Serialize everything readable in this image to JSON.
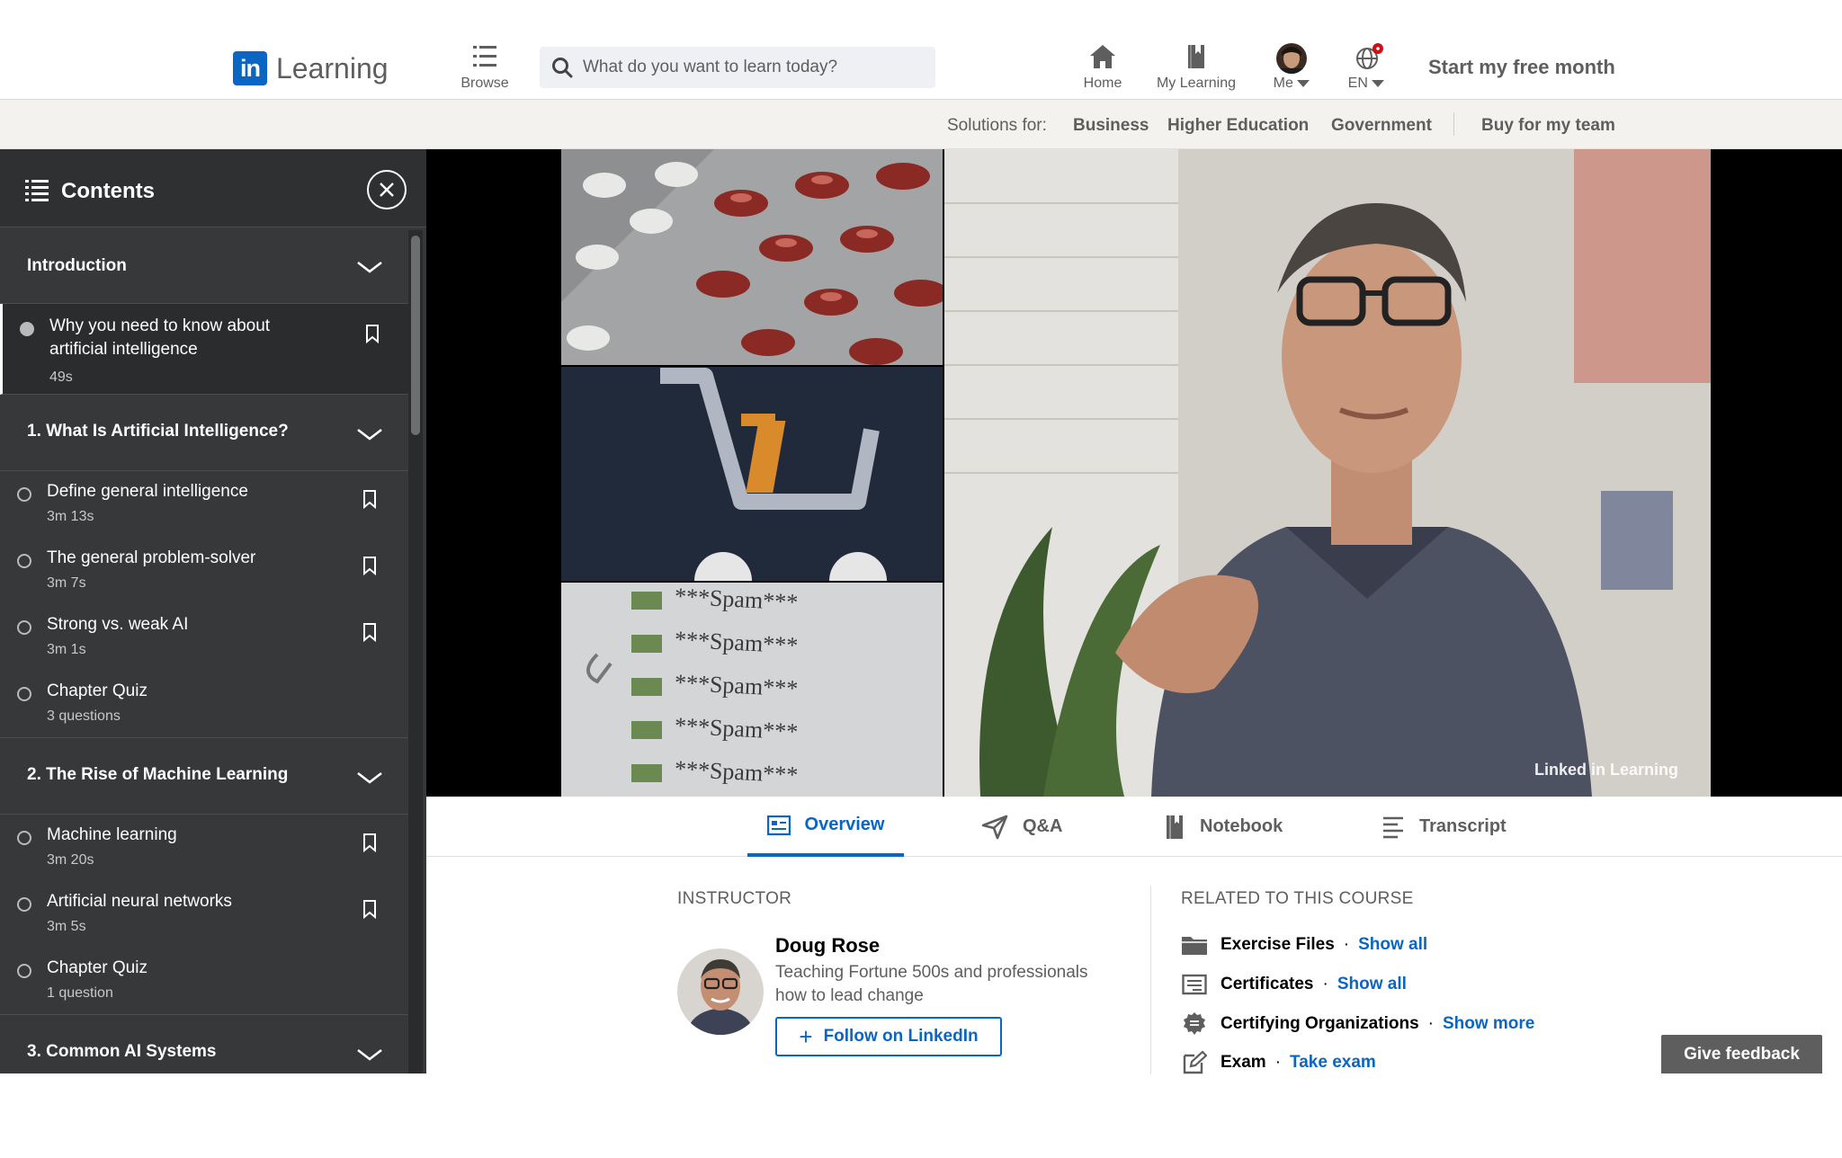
{
  "header": {
    "logo_text": "Learning",
    "logo_badge": "in",
    "browse_label": "Browse",
    "search_placeholder": "What do you want to learn today?",
    "nav": {
      "home": "Home",
      "my_learning": "My Learning",
      "me": "Me",
      "language": "EN"
    },
    "cta": "Start my free month"
  },
  "subbar": {
    "solutions_label": "Solutions for:",
    "business": "Business",
    "higher_education": "Higher Education",
    "government": "Government",
    "buy_team": "Buy for my team"
  },
  "sidebar": {
    "title": "Contents",
    "sections": [
      {
        "title": "Introduction",
        "items": [
          {
            "title": "Why you need to know about artificial intelligence",
            "duration": "49s"
          }
        ]
      },
      {
        "title": "1. What Is Artificial Intelligence?",
        "items": [
          {
            "title": "Define general intelligence",
            "duration": "3m 13s"
          },
          {
            "title": "The general problem-solver",
            "duration": "3m 7s"
          },
          {
            "title": "Strong vs. weak AI",
            "duration": "3m 1s"
          },
          {
            "title": "Chapter Quiz",
            "duration": "3 questions"
          }
        ]
      },
      {
        "title": "2. The Rise of Machine Learning",
        "items": [
          {
            "title": "Machine learning",
            "duration": "3m 20s"
          },
          {
            "title": "Artificial neural networks",
            "duration": "3m 5s"
          },
          {
            "title": "Chapter Quiz",
            "duration": "1 question"
          }
        ]
      },
      {
        "title": "3. Common AI Systems",
        "items": []
      }
    ]
  },
  "video": {
    "spam_lines": [
      "***Spam***",
      "***Spam***",
      "***Spam***",
      "***Spam***",
      "***Spam***"
    ],
    "watermark": "Linked in Learning"
  },
  "tabs": [
    {
      "label": "Overview",
      "icon": "overview-icon"
    },
    {
      "label": "Q&A",
      "icon": "paper-plane-icon"
    },
    {
      "label": "Notebook",
      "icon": "notebook-icon"
    },
    {
      "label": "Transcript",
      "icon": "transcript-icon"
    }
  ],
  "overview": {
    "instructor_heading": "INSTRUCTOR",
    "instructor_name": "Doug Rose",
    "instructor_desc": "Teaching Fortune 500s and professionals how to lead change",
    "follow_label": "Follow on LinkedIn",
    "related_heading": "RELATED TO THIS COURSE",
    "related": [
      {
        "label": "Exercise Files",
        "link": "Show all",
        "icon": "folder-icon"
      },
      {
        "label": "Certificates",
        "link": "Show all",
        "icon": "certificate-icon"
      },
      {
        "label": "Certifying Organizations",
        "link": "Show more",
        "icon": "badge-icon"
      },
      {
        "label": "Exam",
        "link": "Take exam",
        "icon": "exam-edit-icon"
      }
    ]
  },
  "feedback_label": "Give feedback",
  "colors": {
    "brand": "#0a66c2",
    "sidebar_bg": "#37383a",
    "notification": "#cc1016"
  }
}
